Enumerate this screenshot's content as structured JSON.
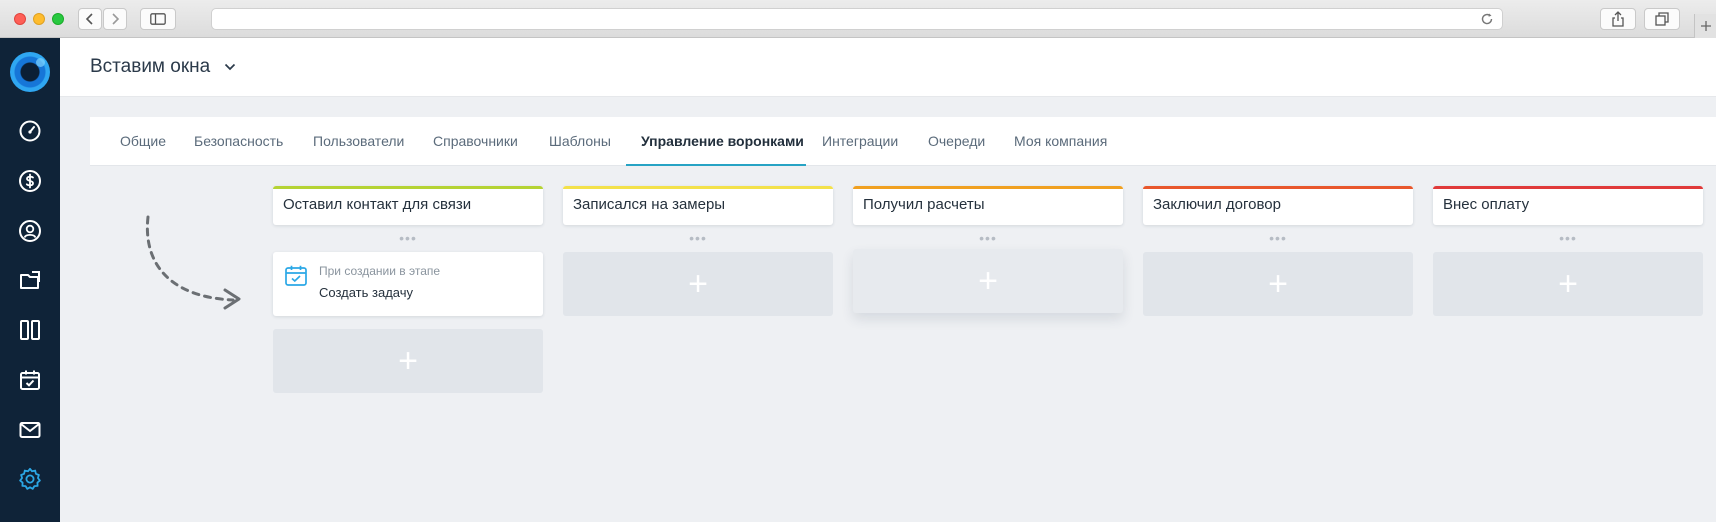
{
  "browser": {
    "address_value": "",
    "traffic_lights": [
      "close",
      "minimize",
      "zoom"
    ],
    "icons": [
      "back-icon",
      "forward-icon",
      "sidebar-toggle-icon",
      "reload-icon",
      "share-icon",
      "tabs-icon",
      "new-tab-icon"
    ]
  },
  "sidebar": {
    "items": [
      {
        "name": "dashboard",
        "icon": "speedometer-icon"
      },
      {
        "name": "finance",
        "icon": "dollar-icon"
      },
      {
        "name": "contacts",
        "icon": "user-icon"
      },
      {
        "name": "documents",
        "icon": "folder-icon"
      },
      {
        "name": "boards",
        "icon": "columns-icon"
      },
      {
        "name": "calendar",
        "icon": "calendar-check-icon"
      },
      {
        "name": "mail",
        "icon": "envelope-icon"
      },
      {
        "name": "settings",
        "icon": "gear-icon",
        "active": true
      }
    ],
    "active_color": "#2ba8e6"
  },
  "header": {
    "workspace": "Вставим окна"
  },
  "tabs": [
    {
      "label": "Общие"
    },
    {
      "label": "Безопасность"
    },
    {
      "label": "Пользователи"
    },
    {
      "label": "Справочники"
    },
    {
      "label": "Шаблоны"
    },
    {
      "label": "Управление воронками",
      "active": true
    },
    {
      "label": "Интеграции"
    },
    {
      "label": "Очереди"
    },
    {
      "label": "Моя компания"
    }
  ],
  "funnel": {
    "stages": [
      {
        "title": "Оставил контакт для связи",
        "color": "#b5d334"
      },
      {
        "title": "Записался на замеры",
        "color": "#f3e14a"
      },
      {
        "title": "Получил расчеты",
        "color": "#f0a020"
      },
      {
        "title": "Заключил договор",
        "color": "#e8572c"
      },
      {
        "title": "Внес оплату",
        "color": "#e03a3a"
      }
    ],
    "dots": "•••",
    "add_symbol": "+",
    "task": {
      "trigger": "При создании в этапе",
      "action": "Создать задачу"
    }
  }
}
